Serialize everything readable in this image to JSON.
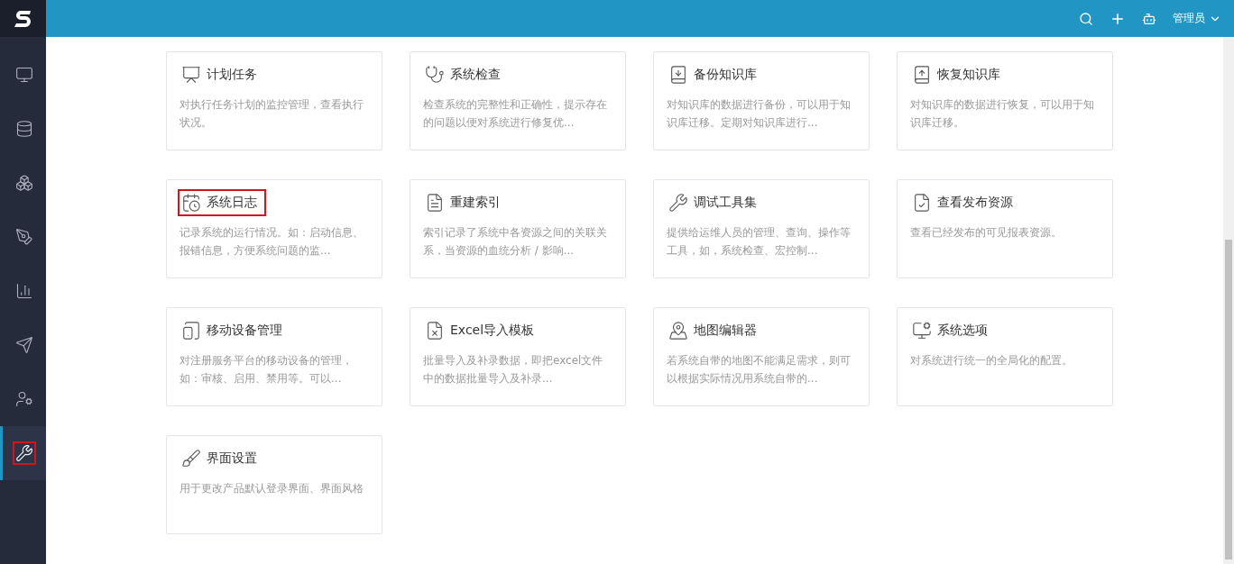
{
  "header": {
    "user": "管理员"
  },
  "sidebar": {
    "items": [
      {
        "selected": false,
        "highlighted": false
      },
      {
        "selected": false,
        "highlighted": false
      },
      {
        "selected": false,
        "highlighted": false
      },
      {
        "selected": false,
        "highlighted": false
      },
      {
        "selected": false,
        "highlighted": false
      },
      {
        "selected": false,
        "highlighted": false
      },
      {
        "selected": false,
        "highlighted": false
      },
      {
        "selected": true,
        "highlighted": true
      }
    ]
  },
  "cards": [
    {
      "title": "计划任务",
      "description": "对执行任务计划的监控管理，查看执行状况。",
      "highlighted": false
    },
    {
      "title": "系统检查",
      "description": "检查系统的完整性和正确性，提示存在的问题以便对系统进行修复优...",
      "highlighted": false
    },
    {
      "title": "备份知识库",
      "description": "对知识库的数据进行备份，可以用于知识库迁移。定期对知识库进行...",
      "highlighted": false
    },
    {
      "title": "恢复知识库",
      "description": "对知识库的数据进行恢复，可以用于知识库迁移。",
      "highlighted": false
    },
    {
      "title": "系统日志",
      "description": "记录系统的运行情况。如：启动信息、报错信息，方便系统问题的监...",
      "highlighted": true
    },
    {
      "title": "重建索引",
      "description": "索引记录了系统中各资源之间的关联关系，当资源的血统分析 / 影响...",
      "highlighted": false
    },
    {
      "title": "调试工具集",
      "description": "提供给运维人员的管理、查询、操作等工具，如，系统检查、宏控制...",
      "highlighted": false
    },
    {
      "title": "查看发布资源",
      "description": "查看已经发布的可见报表资源。",
      "highlighted": false
    },
    {
      "title": "移动设备管理",
      "description": "对注册服务平台的移动设备的管理，如：审核、启用、禁用等。可以...",
      "highlighted": false
    },
    {
      "title": "Excel导入模板",
      "description": "批量导入及补录数据，即把excel文件中的数据批量导入及补录...",
      "highlighted": false
    },
    {
      "title": "地图编辑器",
      "description": "若系统自带的地图不能满足需求，则可以根据实际情况用系统自带的...",
      "highlighted": false
    },
    {
      "title": "系统选项",
      "description": "对系统进行统一的全局化的配置。",
      "highlighted": false
    },
    {
      "title": "界面设置",
      "description": "用于更改产品默认登录界面、界面风格",
      "highlighted": false
    }
  ]
}
